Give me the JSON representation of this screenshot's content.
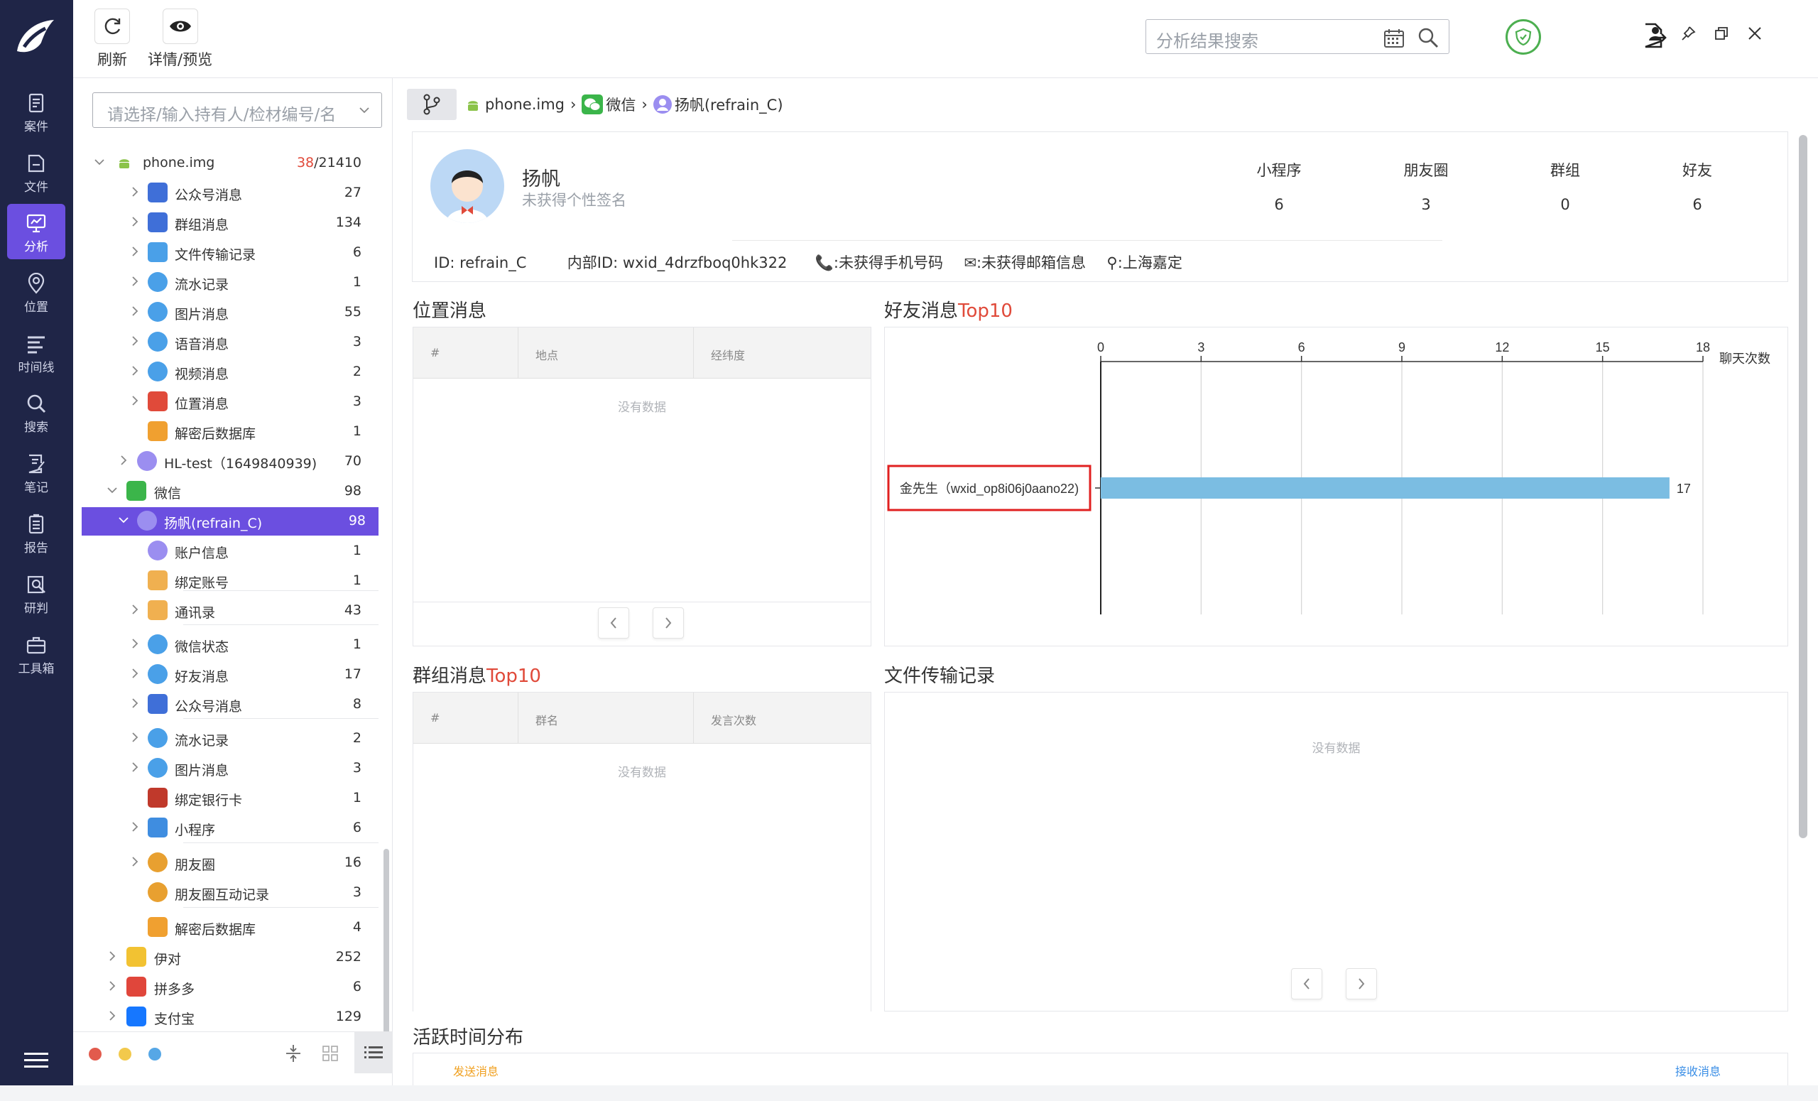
{
  "nav": {
    "logo": "app-logo",
    "items": [
      {
        "label": "案件",
        "icon": "case-icon"
      },
      {
        "label": "文件",
        "icon": "file-icon"
      },
      {
        "label": "分析",
        "icon": "analysis-icon",
        "active": true
      },
      {
        "label": "位置",
        "icon": "location-icon"
      },
      {
        "label": "时间线",
        "icon": "timeline-icon"
      },
      {
        "label": "搜索",
        "icon": "search-icon"
      },
      {
        "label": "笔记",
        "icon": "note-icon"
      },
      {
        "label": "报告",
        "icon": "report-icon"
      },
      {
        "label": "研判",
        "icon": "judge-icon"
      },
      {
        "label": "工具箱",
        "icon": "toolbox-icon"
      }
    ]
  },
  "toolbar": {
    "refresh_label": "刷新",
    "preview_label": "详情/预览",
    "search_placeholder": "分析结果搜索"
  },
  "sidebar": {
    "select_placeholder": "请选择/输入持有人/检材编号/名",
    "tree": [
      {
        "label": "phone.img",
        "count_red": "38",
        "count": "/21410",
        "icon": "android-icon"
      },
      {
        "label": "公众号消息",
        "count": "27",
        "icon": "official-account-icon"
      },
      {
        "label": "群组消息",
        "count": "134",
        "icon": "group-message-icon"
      },
      {
        "label": "文件传输记录",
        "count": "6",
        "icon": "file-transfer-icon"
      },
      {
        "label": "流水记录",
        "count": "1",
        "icon": "chat-bubble-icon"
      },
      {
        "label": "图片消息",
        "count": "55",
        "icon": "chat-bubble-icon"
      },
      {
        "label": "语音消息",
        "count": "3",
        "icon": "chat-bubble-icon"
      },
      {
        "label": "视频消息",
        "count": "2",
        "icon": "chat-bubble-icon"
      },
      {
        "label": "位置消息",
        "count": "3",
        "icon": "location-pin-icon"
      },
      {
        "label": "解密后数据库",
        "count": "1",
        "icon": "database-icon"
      },
      {
        "label": "HL-test（1649840939)",
        "count": "70",
        "icon": "user-avatar-icon"
      },
      {
        "label": "微信",
        "count": "98",
        "icon": "wechat-icon"
      },
      {
        "label": "扬帆(refrain_C)",
        "count": "98",
        "icon": "user-avatar-icon"
      },
      {
        "label": "账户信息",
        "count": "1",
        "icon": "user-avatar-icon"
      },
      {
        "label": "绑定账号",
        "count": "1",
        "icon": "phone-icon"
      },
      {
        "label": "通讯录",
        "count": "43",
        "icon": "phone-icon"
      },
      {
        "label": "微信状态",
        "count": "1",
        "icon": "chat-bubble-icon"
      },
      {
        "label": "好友消息",
        "count": "17",
        "icon": "chat-bubble-icon"
      },
      {
        "label": "公众号消息",
        "count": "8",
        "icon": "official-account-icon"
      },
      {
        "label": "流水记录",
        "count": "2",
        "icon": "chat-bubble-icon"
      },
      {
        "label": "图片消息",
        "count": "3",
        "icon": "chat-bubble-icon"
      },
      {
        "label": "绑定银行卡",
        "count": "1",
        "icon": "bank-card-icon"
      },
      {
        "label": "小程序",
        "count": "6",
        "icon": "mini-program-icon"
      },
      {
        "label": "朋友圈",
        "count": "16",
        "icon": "moments-icon"
      },
      {
        "label": "朋友圈互动记录",
        "count": "3",
        "icon": "moments-icon"
      },
      {
        "label": "解密后数据库",
        "count": "4",
        "icon": "database-icon"
      },
      {
        "label": "伊对",
        "count": "252",
        "icon": "yidui-icon"
      },
      {
        "label": "拼多多",
        "count": "6",
        "icon": "pinduoduo-icon"
      },
      {
        "label": "支付宝",
        "count": "129",
        "icon": "alipay-icon"
      }
    ]
  },
  "breadcrumb": {
    "items": [
      {
        "label": "phone.img",
        "icon": "android-icon"
      },
      {
        "label": "微信",
        "icon": "wechat-icon"
      },
      {
        "label": "扬帆(refrain_C)",
        "icon": "user-avatar-icon"
      }
    ]
  },
  "profile": {
    "name": "扬帆",
    "signature": "未获得个性签名",
    "stats": [
      {
        "label": "小程序",
        "value": "6"
      },
      {
        "label": "朋友圈",
        "value": "3"
      },
      {
        "label": "群组",
        "value": "0"
      },
      {
        "label": "好友",
        "value": "6"
      }
    ],
    "id_text": "ID: refrain_C",
    "internal_id_text": "内部ID: wxid_4drzfboq0hk322",
    "phone_text": ":未获得手机号码",
    "email_text": ":未获得邮箱信息",
    "location_text": ":上海嘉定"
  },
  "location_section": {
    "title": "位置消息",
    "columns": [
      "#",
      "地点",
      "经纬度"
    ],
    "empty_text": "没有数据"
  },
  "friend_section": {
    "title_main": "好友消息",
    "title_accent": "Top10"
  },
  "group_section": {
    "title_main": "群组消息",
    "title_accent": "Top10",
    "columns": [
      "#",
      "群名",
      "发言次数"
    ],
    "empty_text": "没有数据"
  },
  "file_section": {
    "title": "文件传输记录",
    "empty_text": "没有数据"
  },
  "activity_section": {
    "title": "活跃时间分布",
    "legend_left": "发送消息",
    "legend_right": "接收消息"
  },
  "chart_data": {
    "type": "bar",
    "orientation": "horizontal",
    "categories": [
      "金先生（wxid_op8i06j0aano22)"
    ],
    "values": [
      17
    ],
    "xlim": [
      0,
      18
    ],
    "ticks": [
      0,
      3,
      6,
      9,
      12,
      15,
      18
    ],
    "xlabel": "聊天次数",
    "bar_color": "#7bbde2",
    "grid": true
  },
  "colors": {
    "nav_bg": "#1f2547",
    "accent": "#6b4fe0",
    "red": "#e04a3a",
    "shield_green": "#4caf50"
  }
}
